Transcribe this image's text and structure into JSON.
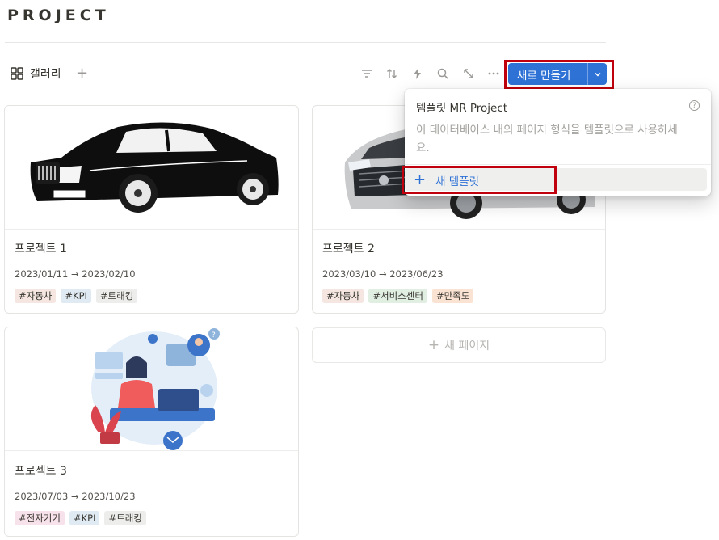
{
  "page": {
    "title": "PROJECT"
  },
  "view": {
    "tab_label": "갤러리",
    "tab_icon": "gallery-grid-icon",
    "add_view": "+",
    "tools": [
      "filter-icon",
      "sort-icon",
      "automation-lightning-icon",
      "search-icon",
      "expand-icon",
      "more-icon"
    ],
    "new_button": {
      "label": "새로 만들기",
      "icon": "chevron-down-icon"
    }
  },
  "cards": [
    {
      "name": "프로젝트 1",
      "dates": "2023/01/11 → 2023/02/10",
      "tags": [
        {
          "text": "#자동차",
          "color": "#f5e6e1"
        },
        {
          "text": "#KPI",
          "color": "#dfeaf3"
        },
        {
          "text": "#트래킹",
          "color": "#ededeb"
        }
      ],
      "cover": "black-sedan"
    },
    {
      "name": "프로젝트 2",
      "dates": "2023/03/10 → 2023/06/23",
      "tags": [
        {
          "text": "#자동차",
          "color": "#f5e6e1"
        },
        {
          "text": "#서비스센터",
          "color": "#e1efe3"
        },
        {
          "text": "#만족도",
          "color": "#fbe3d4"
        }
      ],
      "cover": "silver-minivan"
    },
    {
      "name": "프로젝트 3",
      "dates": "2023/07/03 → 2023/10/23",
      "tags": [
        {
          "text": "#전자기기",
          "color": "#f7e1ea"
        },
        {
          "text": "#KPI",
          "color": "#dfeaf3"
        },
        {
          "text": "#트래킹",
          "color": "#ededeb"
        }
      ],
      "cover": "remote-work-illustration"
    }
  ],
  "new_page": {
    "label": "새 페이지",
    "icon": "+"
  },
  "template_menu": {
    "title": "템플릿 MR Project",
    "help_icon": "?",
    "description": "이 데이터베이스 내의 페이지 형식을 템플릿으로 사용하세요.",
    "new_template": "새 템플릿",
    "new_template_icon": "+"
  },
  "colors": {
    "accent": "#2f72d6",
    "highlight": "#c0000c"
  }
}
